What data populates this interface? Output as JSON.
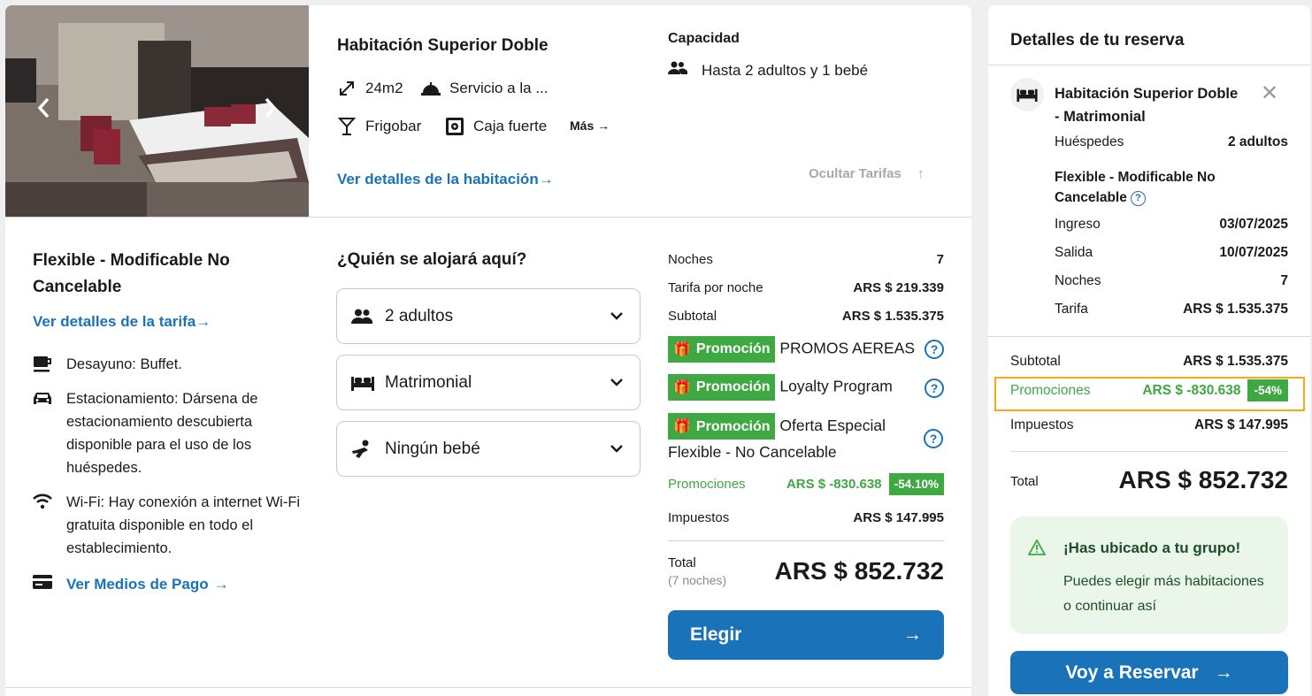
{
  "room": {
    "title": "Habitación Superior Doble",
    "features": {
      "size": "24m2",
      "service": "Servicio a la ...",
      "minibar": "Frigobar",
      "safe": "Caja fuerte",
      "more": "Más"
    },
    "details_link": "Ver detalles de la habitación",
    "capacity_title": "Capacidad",
    "capacity_text": "Hasta 2 adultos y 1 bebé",
    "hide_rates": "Ocultar Tarifas"
  },
  "rate": {
    "title": "Flexible - Modificable No Cancelable",
    "details_link": "Ver detalles de la tarifa",
    "amenities": {
      "breakfast": "Desayuno: Buffet.",
      "parking": "Estacionamiento: Dársena de estacionamiento descubierta disponible para el uso de los huéspedes.",
      "wifi": "Wi-Fi: Hay conexión a internet Wi-Fi gratuita disponible en todo el establecimiento."
    },
    "payment_link": "Ver Medios de Pago"
  },
  "guests": {
    "title": "¿Quién se alojará aquí?",
    "adults": "2 adultos",
    "bed": "Matrimonial",
    "baby": "Ningún bebé"
  },
  "price": {
    "nights_label": "Noches",
    "nights_value": "7",
    "per_night_label": "Tarifa por noche",
    "per_night_value": "ARS $ 219.339",
    "subtotal_label": "Subtotal",
    "subtotal_value": "ARS $ 1.535.375",
    "promo_badge": "Promoción",
    "promo1": "PROMOS AEREAS",
    "promo2": "Loyalty Program",
    "promo3": "Oferta Especial Flexible - No Cancelable",
    "promos_label": "Promociones",
    "promos_value": "ARS $ -830.638",
    "promos_pct": "-54.10%",
    "taxes_label": "Impuestos",
    "taxes_value": "ARS $ 147.995",
    "total_label": "Total",
    "total_sub": "(7 noches)",
    "total_value": "ARS $ 852.732",
    "choose": "Elegir"
  },
  "summary": {
    "title": "Detalles de tu reserva",
    "room_name": "Habitación Superior Doble - Matrimonial",
    "guests_label": "Huéspedes",
    "guests_value": "2 adultos",
    "rate_name": "Flexible - Modificable No Cancelable",
    "checkin_label": "Ingreso",
    "checkin_value": "03/07/2025",
    "checkout_label": "Salida",
    "checkout_value": "10/07/2025",
    "nights_label": "Noches",
    "nights_value": "7",
    "rate_label": "Tarifa",
    "rate_value": "ARS $ 1.535.375",
    "subtotal_label": "Subtotal",
    "subtotal_value": "ARS $ 1.535.375",
    "promos_label": "Promociones",
    "promos_value": "ARS $ -830.638",
    "promos_pct": "-54%",
    "taxes_label": "Impuestos",
    "taxes_value": "ARS $ 147.995",
    "total_label": "Total",
    "total_value": "ARS $ 852.732",
    "group_title": "¡Has ubicado a tu grupo!",
    "group_text": "Puedes elegir más habitaciones o continuar así",
    "reserve_button": "Voy a Reservar"
  },
  "colors": {
    "accent_blue": "#1a73b8",
    "promo_green": "#3ea843",
    "highlight_orange": "#f5a914",
    "group_bg": "#eaf6ea"
  },
  "icons": [
    "chevron-left-icon",
    "chevron-right-icon",
    "resize-icon",
    "room-service-icon",
    "cocktail-icon",
    "safe-icon",
    "arrow-right-icon",
    "people-icon",
    "arrow-up-icon",
    "coffee-icon",
    "car-icon",
    "wifi-icon",
    "card-icon",
    "chevron-down-icon",
    "bed-icon",
    "baby-icon",
    "gift-icon",
    "help-icon",
    "close-icon",
    "warning-icon"
  ]
}
